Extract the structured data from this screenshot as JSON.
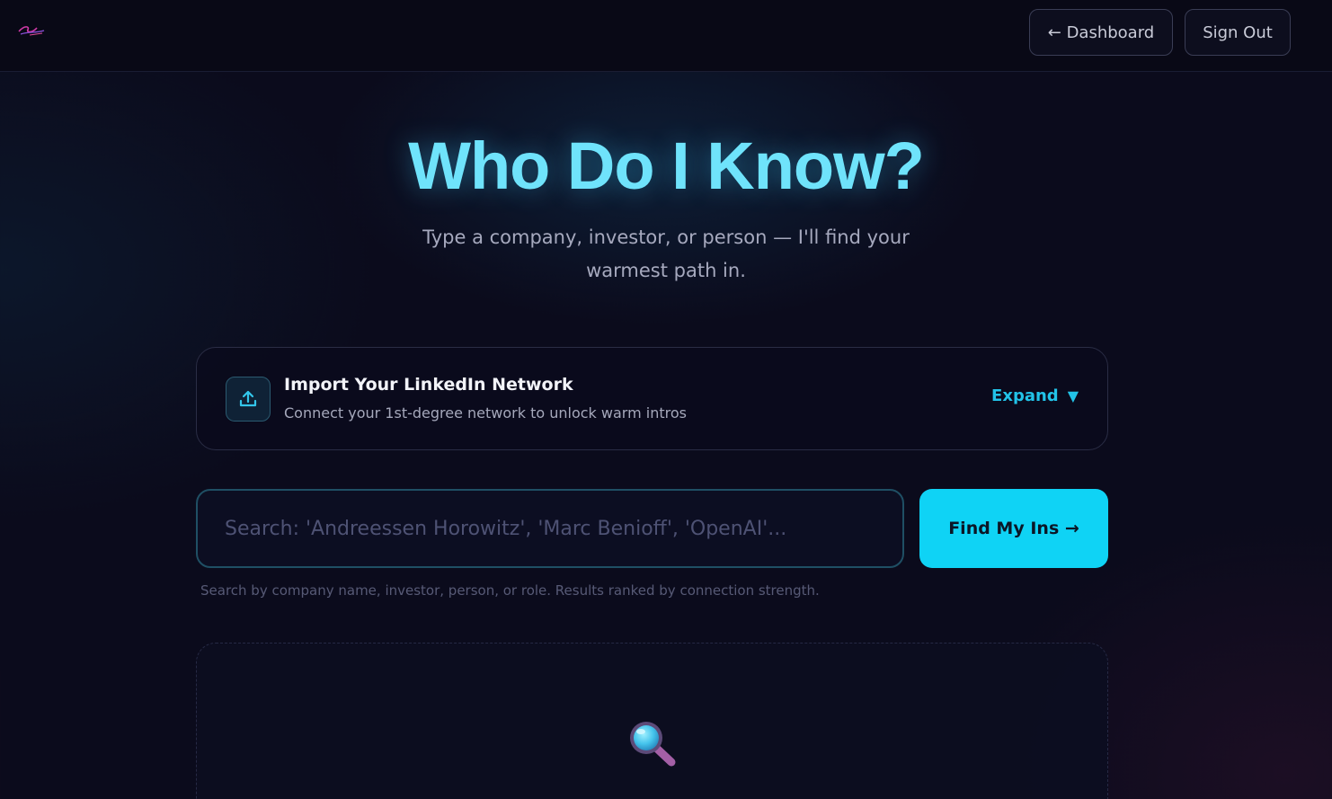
{
  "header": {
    "logo_icon": "brand-logo-icon",
    "dashboard_label": "← Dashboard",
    "signout_label": "Sign Out"
  },
  "hero": {
    "title": "Who Do I Know?",
    "subtitle": "Type a company, investor, or person — I'll find your warmest path in."
  },
  "import": {
    "icon": "upload-icon",
    "title": "Import Your LinkedIn Network",
    "description": "Connect your 1st-degree network to unlock warm intros",
    "expand_label": "Expand",
    "expand_icon": "▼"
  },
  "search": {
    "placeholder": "Search: 'Andreessen Horowitz', 'Marc Benioff', 'OpenAI'...",
    "value": "",
    "button_label": "Find My Ins →",
    "hint": "Search by company name, investor, person, or role. Results ranked by connection strength."
  },
  "results": {
    "empty_icon": "magnifying-glass-icon"
  },
  "colors": {
    "accent": "#0fd3f5",
    "title": "#6fe3fb",
    "background": "#0b0b1c"
  }
}
